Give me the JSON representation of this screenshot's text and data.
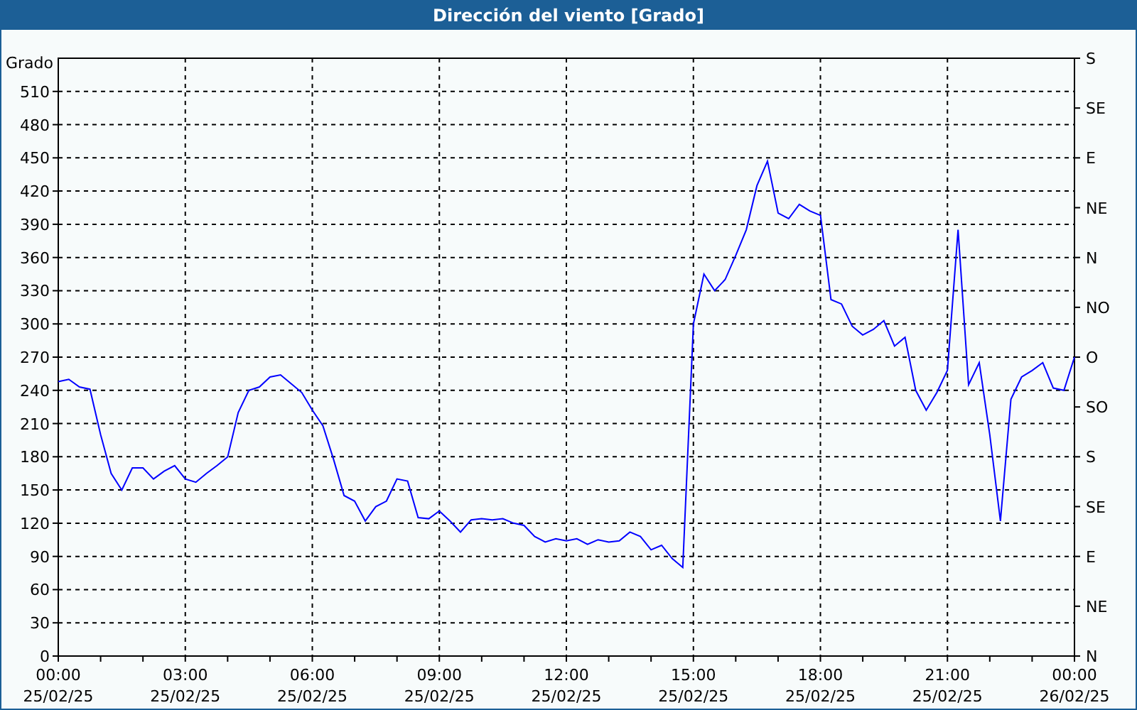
{
  "window": {
    "title": "Dirección del viento [Grado]"
  },
  "chart": {
    "chart_data": {
      "type": "line",
      "ylabel": "Grado",
      "categories": [
        "00:00 25/02/25",
        null,
        null,
        null,
        null,
        null,
        null,
        null,
        null,
        null,
        null,
        null,
        "03:00 25/02/25",
        null,
        null,
        null,
        null,
        null,
        null,
        null,
        null,
        null,
        null,
        null,
        "06:00 25/02/25",
        null,
        null,
        null,
        null,
        null,
        null,
        null,
        null,
        null,
        null,
        null,
        "09:00 25/02/25",
        null,
        null,
        null,
        null,
        null,
        null,
        null,
        null,
        null,
        null,
        null,
        "12:00 25/02/25",
        null,
        null,
        null,
        null,
        null,
        null,
        null,
        null,
        null,
        null,
        null,
        "15:00 25/02/25",
        null,
        null,
        null,
        null,
        null,
        null,
        null,
        null,
        null,
        null,
        null,
        "18:00 25/02/25",
        null,
        null,
        null,
        null,
        null,
        null,
        null,
        null,
        null,
        null,
        null,
        "21:00 25/02/25",
        null,
        null,
        null,
        null,
        null,
        null,
        null,
        null,
        null,
        null,
        null,
        "00:00 26/02/25"
      ],
      "series": [
        {
          "color": "#0000ff",
          "values": [
            248,
            250,
            243,
            241,
            200,
            165,
            150,
            170,
            170,
            160,
            167,
            172,
            160,
            157,
            165,
            172,
            180,
            220,
            240,
            243,
            252,
            254,
            246,
            238,
            222,
            208,
            178,
            145,
            140,
            122,
            135,
            140,
            160,
            158,
            125,
            124,
            131,
            122,
            112,
            123,
            124,
            123,
            124,
            120,
            118,
            108,
            103,
            106,
            104,
            106,
            101,
            105,
            103,
            104,
            112,
            108,
            96,
            100,
            88,
            80,
            300,
            345,
            330,
            340,
            362,
            385,
            425,
            447,
            400,
            395,
            408,
            402,
            398,
            322,
            318,
            298,
            290,
            295,
            303,
            280,
            288,
            240,
            222,
            238,
            258,
            385,
            245,
            265,
            200,
            122,
            232,
            252,
            258,
            265,
            242,
            240,
            270
          ]
        }
      ],
      "ylim": [
        0,
        540
      ],
      "grid": true,
      "yticks": [
        0,
        30,
        60,
        90,
        120,
        150,
        180,
        210,
        240,
        270,
        300,
        330,
        360,
        390,
        420,
        450,
        480,
        510
      ]
    },
    "right_axis": {
      "labels": [
        "S",
        "SE",
        "E",
        "NE",
        "N",
        "NO",
        "O",
        "SO",
        "S",
        "SE",
        "E",
        "NE",
        "N"
      ]
    }
  }
}
